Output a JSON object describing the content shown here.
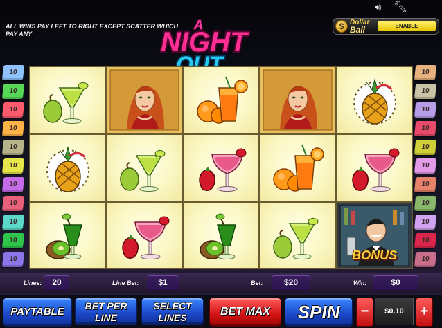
{
  "topbar": {
    "volume_icon": "speaker-icon",
    "settings_icon": "wrench-icon"
  },
  "info_text": "ALL WINS PAY LEFT TO RIGHT EXCEPT SCATTER WHICH PAY ANY",
  "logo": {
    "line1": "A",
    "line2": "NIGHT",
    "line3": "OUT"
  },
  "dollar_ball": {
    "coin_symbol": "$",
    "label_line1": "Dollar",
    "label_line2": "Ball",
    "button": "ENABLE"
  },
  "lines_left": [
    {
      "label": "10",
      "color": "#8ec3ff"
    },
    {
      "label": "10",
      "color": "#57d957"
    },
    {
      "label": "10",
      "color": "#ff5a6e"
    },
    {
      "label": "10",
      "color": "#ffb347"
    },
    {
      "label": "10",
      "color": "#b8b48a"
    },
    {
      "label": "10",
      "color": "#e6e64a"
    },
    {
      "label": "10",
      "color": "#c56ae8"
    },
    {
      "label": "10",
      "color": "#e8607a"
    },
    {
      "label": "10",
      "color": "#5cd8c8"
    },
    {
      "label": "10",
      "color": "#2fc44a"
    },
    {
      "label": "10",
      "color": "#8a76e8"
    }
  ],
  "lines_right": [
    {
      "label": "10",
      "color": "#e8b280"
    },
    {
      "label": "10",
      "color": "#c9c4a6"
    },
    {
      "label": "10",
      "color": "#b79de8"
    },
    {
      "label": "10",
      "color": "#e84a6a"
    },
    {
      "label": "10",
      "color": "#cfcf3a"
    },
    {
      "label": "10",
      "color": "#e39ae8"
    },
    {
      "label": "10",
      "color": "#e8826a"
    },
    {
      "label": "10",
      "color": "#8ab86a"
    },
    {
      "label": "10",
      "color": "#d0a4f0"
    },
    {
      "label": "10",
      "color": "#d9264a"
    },
    {
      "label": "10",
      "color": "#c86e8a"
    }
  ],
  "reels": [
    [
      "green-cocktail",
      "red-haired-woman",
      "orange-cocktail",
      "red-haired-woman",
      "pineapple"
    ],
    [
      "pineapple",
      "green-cocktail",
      "strawberry-cocktail",
      "orange-cocktail",
      "strawberry-cocktail"
    ],
    [
      "kiwi-cocktail",
      "strawberry-cocktail",
      "kiwi-cocktail",
      "green-cocktail",
      "bartender-bonus"
    ]
  ],
  "bonus_label": "BONUS",
  "infobar": {
    "lines_label": "Lines:",
    "lines_value": "20",
    "line_bet_label": "Line Bet:",
    "line_bet_value": "$1",
    "bet_label": "Bet:",
    "bet_value": "$20",
    "win_label": "Win:",
    "win_value": "$0"
  },
  "buttons": {
    "paytable": "PAYTABLE",
    "bet_per_line_1": "BET PER",
    "bet_per_line_2": "LINE",
    "select_lines_1": "SELECT",
    "select_lines_2": "LINES",
    "bet_max": "BET MAX",
    "spin": "SPIN",
    "minus": "−",
    "coin_value": "$0.10",
    "plus": "+"
  }
}
